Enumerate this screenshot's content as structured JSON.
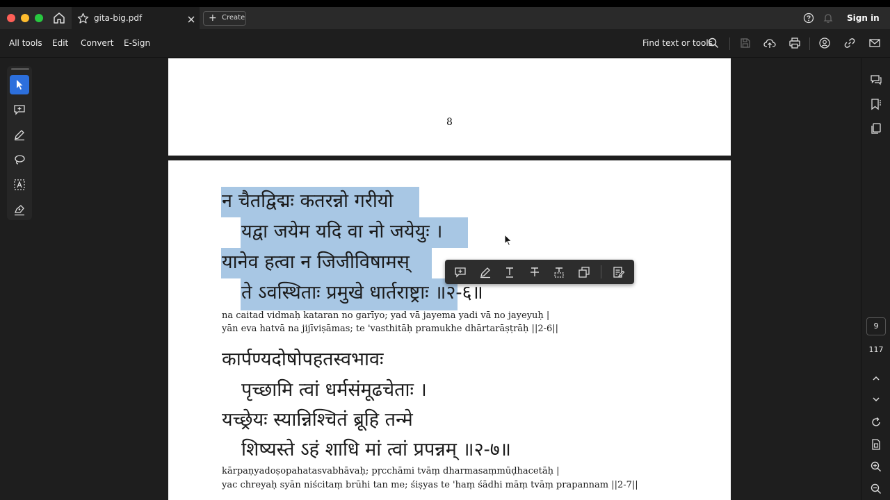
{
  "titlebar": {
    "tab_title": "gita-big.pdf",
    "create_label": "Create",
    "create_plus": "+",
    "sign_in": "Sign in"
  },
  "menubar": {
    "items": [
      "All tools",
      "Edit",
      "Convert",
      "E-Sign"
    ],
    "find_label": "Find text or tools"
  },
  "navigation": {
    "current_page": "9",
    "total_pages": "117"
  },
  "document": {
    "page_number": "8",
    "verse_6": {
      "line1": "न चैतद्विद्मः कतरन्नो गरीयो",
      "line2": "यद्वा जयेम यदि वा नो जयेयुः ।",
      "line3": "यानेव हत्वा न जिजीविषामस्",
      "line4": "ते ऽवस्थिताः प्रमुखे धार्तराष्ट्राः ॥२-६॥",
      "trans1": "na caitad vidmaḥ kataran no garīyo; yad vā jayema yadi vā no jayeyuḥ |",
      "trans2": "yān eva hatvā na jijīviṣāmas; te 'vasthitāḥ pramukhe dhārtarāṣṭrāḥ ||2-6||"
    },
    "verse_7": {
      "line1": "कार्पण्यदोषोपहतस्वभावः",
      "line2": "पृच्छामि त्वां धर्मसंमूढचेताः ।",
      "line3": "यच्छ्रेयः स्यान्निश्चितं ब्रूहि तन्मे",
      "line4": "शिष्यस्ते ऽहं शाधि मां त्वां प्रपन्नम् ॥२-७॥",
      "trans1": "kārpaṇyadoṣopahatasvabhāvaḥ; pṛcchāmi tvāṃ dharmasaṃmūḍhacetāḥ |",
      "trans2": "yac chreyaḥ syān niścitaṃ brūhi tan me; śiṣyas te 'haṃ śādhi māṃ tvāṃ prapannam ||2-7||"
    }
  },
  "colors": {
    "selection": "#a8c7e4",
    "active_tool": "#2c6fdc",
    "chrome_bg": "#1e1e1e"
  }
}
